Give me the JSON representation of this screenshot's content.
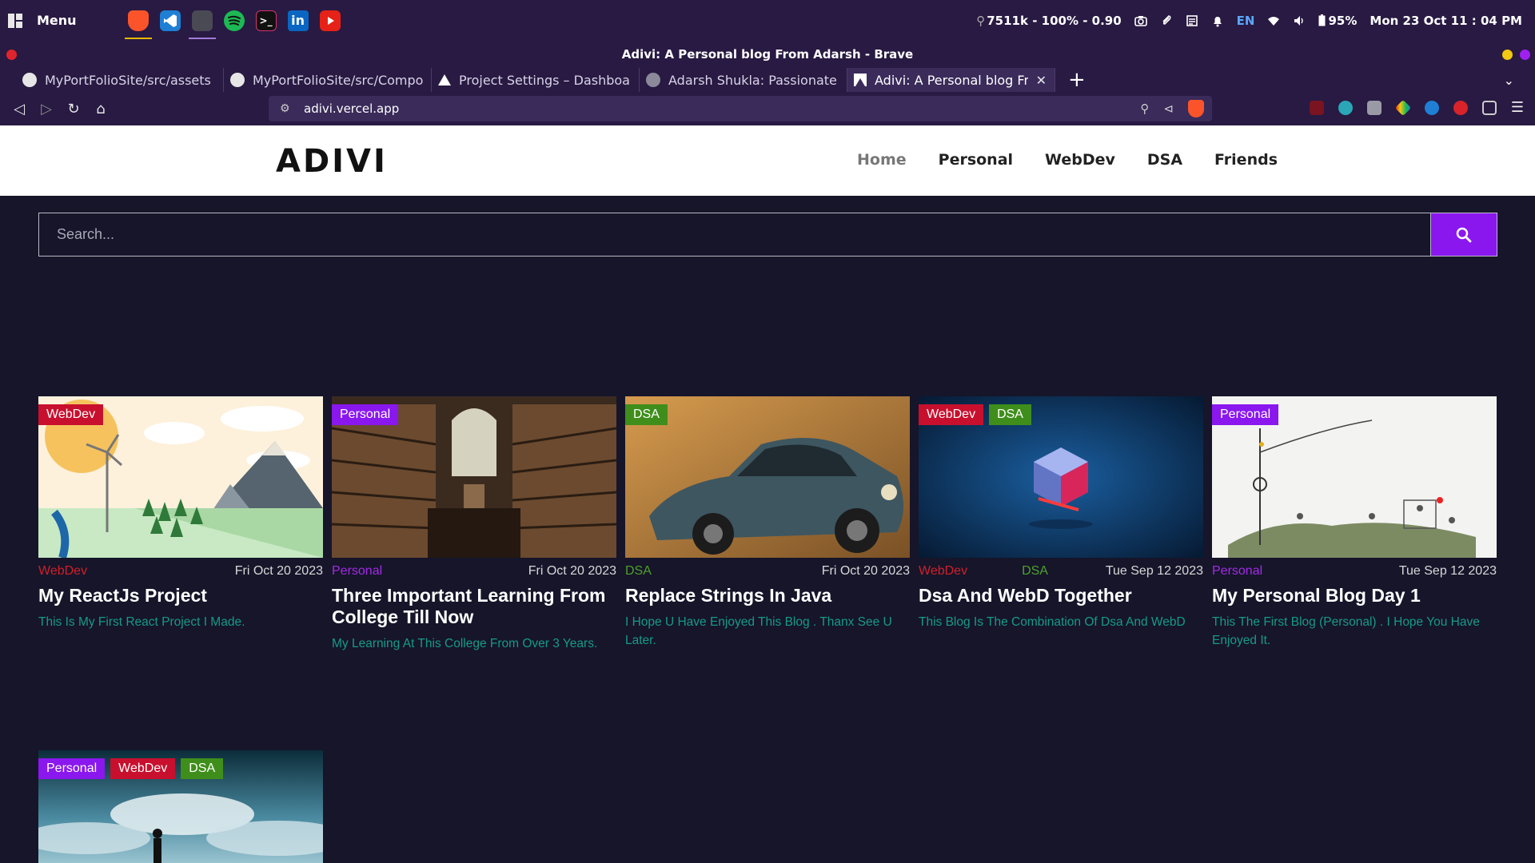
{
  "system_bar": {
    "menu_label": "Menu",
    "stats": "7511k - 100% - 0.90",
    "language": "EN",
    "battery": "95%",
    "datetime": "Mon 23 Oct 11 : 04 PM"
  },
  "browser": {
    "window_title": "Adivi: A Personal blog From Adarsh - Brave",
    "tabs": [
      {
        "title": "MyPortFolioSite/src/assets at",
        "icon": "github-icon"
      },
      {
        "title": "MyPortFolioSite/src/Compone",
        "icon": "github-icon"
      },
      {
        "title": "Project Settings – Dashboard",
        "icon": "vercel-icon"
      },
      {
        "title": "Adarsh Shukla: Passionate W",
        "icon": "avatar-icon"
      },
      {
        "title": "Adivi: A Personal blog Fro",
        "icon": "vercel-icon",
        "active": true
      }
    ],
    "new_tab": "+",
    "url": "adivi.vercel.app"
  },
  "site": {
    "logo": "ADIVI",
    "nav": [
      "Home",
      "Personal",
      "WebDev",
      "DSA",
      "Friends"
    ],
    "search_placeholder": "Search..."
  },
  "tag_colors": {
    "WebDev": "#c8102e",
    "Personal": "#8a17ee",
    "DSA": "#3f8e1b"
  },
  "posts": [
    {
      "tags": [
        "WebDev"
      ],
      "categories": [
        "WebDev"
      ],
      "date": "Fri Oct 20 2023",
      "title": "My ReactJs Project",
      "description": "This Is My First React Project I Made."
    },
    {
      "tags": [
        "Personal"
      ],
      "categories": [
        "Personal"
      ],
      "date": "Fri Oct 20 2023",
      "title": "Three Important Learning From College Till Now",
      "description": "My Learning At This College From Over 3 Years."
    },
    {
      "tags": [
        "DSA"
      ],
      "categories": [
        "DSA"
      ],
      "date": "Fri Oct 20 2023",
      "title": "Replace Strings In Java",
      "description": "I Hope U Have Enjoyed This Blog . Thanx See U Later."
    },
    {
      "tags": [
        "WebDev",
        "DSA"
      ],
      "categories": [
        "WebDev",
        "DSA"
      ],
      "date": "Tue Sep 12 2023",
      "title": "Dsa And WebD Together",
      "description": "This Blog Is The Combination Of Dsa And WebD"
    },
    {
      "tags": [
        "Personal"
      ],
      "categories": [
        "Personal"
      ],
      "date": "Tue Sep 12 2023",
      "title": "My Personal Blog Day 1",
      "description": "This The First Blog (Personal) . I Hope You Have Enjoyed It."
    },
    {
      "tags": [
        "Personal",
        "WebDev",
        "DSA"
      ]
    }
  ]
}
